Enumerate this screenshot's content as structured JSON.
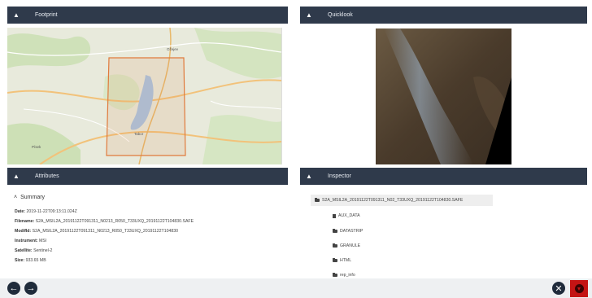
{
  "panels": {
    "footprint": {
      "title": "Footprint"
    },
    "quicklook": {
      "title": "Quicklook"
    },
    "attributes": {
      "title": "Attributes"
    },
    "inspector": {
      "title": "Inspector"
    }
  },
  "icons": {
    "collapse": "chevron-up-icon",
    "back": "arrow-left-icon",
    "forward": "arrow-right-icon",
    "close": "close-icon",
    "download": "download-icon",
    "folder": "folder-icon",
    "file": "file-icon"
  },
  "map": {
    "labels": {
      "city_north": "Ožejev",
      "city_south": "Tabor",
      "city_sw": "Písek"
    }
  },
  "attributes": {
    "summary_label": "Summary",
    "rows": [
      {
        "key": "Date:",
        "value": "2019-11-22T09:13:11.024Z"
      },
      {
        "key": "Filename:",
        "value": "S2A_MSIL2A_20191122T091311_N0213_R050_T33UXQ_20191122T104830.SAFE"
      },
      {
        "key": "ModifId:",
        "value": "S2A_MSIL2A_20191122T091311_N0213_R050_T33UXQ_20191122T104830"
      },
      {
        "key": "Instrument:",
        "value": "MSI"
      },
      {
        "key": "Satellite:",
        "value": "Sentinel-2"
      },
      {
        "key": "Size:",
        "value": "933.65 MB"
      }
    ]
  },
  "inspector": {
    "root": "S2A_MSIL2A_20191122T091311_N02_T33UXQ_20191122T104830.SAFE",
    "children": [
      "AUX_DATA",
      "DATASTRIP",
      "GRANULE",
      "HTML",
      "rep_info"
    ]
  },
  "colors": {
    "header_bg": "#2f3a4b",
    "footprint_outline": "#e07a3c",
    "download_bg": "#c41414"
  }
}
